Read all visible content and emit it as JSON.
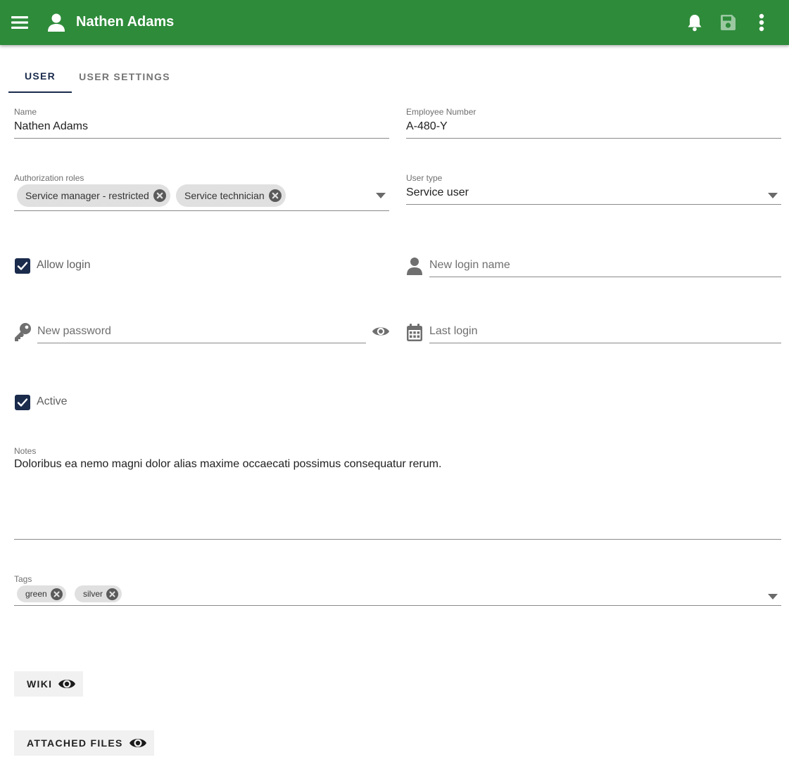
{
  "appbar": {
    "title": "Nathen Adams",
    "icons": [
      "menu-icon",
      "user-icon",
      "bell-icon",
      "save-icon",
      "more-vert-icon"
    ],
    "color": "#2e8b3a"
  },
  "tabs": [
    {
      "label": "USER",
      "active": true
    },
    {
      "label": "USER SETTINGS",
      "active": false
    }
  ],
  "form": {
    "name": {
      "label": "Name",
      "value": "Nathen Adams"
    },
    "employee_number": {
      "label": "Employee Number",
      "value": "A-480-Y"
    },
    "authorization_roles": {
      "label": "Authorization roles",
      "chips": [
        "Service manager - restricted",
        "Service technician"
      ]
    },
    "user_type": {
      "label": "User type",
      "value": "Service user"
    },
    "allow_login": {
      "label": "Allow login",
      "checked": true
    },
    "new_login_name": {
      "placeholder": "New login name"
    },
    "new_password": {
      "placeholder": "New password"
    },
    "last_login": {
      "placeholder": "Last login"
    },
    "active": {
      "label": "Active",
      "checked": true
    },
    "notes": {
      "label": "Notes",
      "value": "Doloribus ea nemo magni dolor alias maxime occaecati possimus consequatur rerum."
    },
    "tags": {
      "label": "Tags",
      "chips": [
        "green",
        "silver"
      ]
    }
  },
  "buttons": {
    "wiki": "WIKI",
    "attached_files": "ATTACHED FILES"
  },
  "colors": {
    "accent": "#1a2b4c",
    "appbar": "#2e8b3a"
  }
}
